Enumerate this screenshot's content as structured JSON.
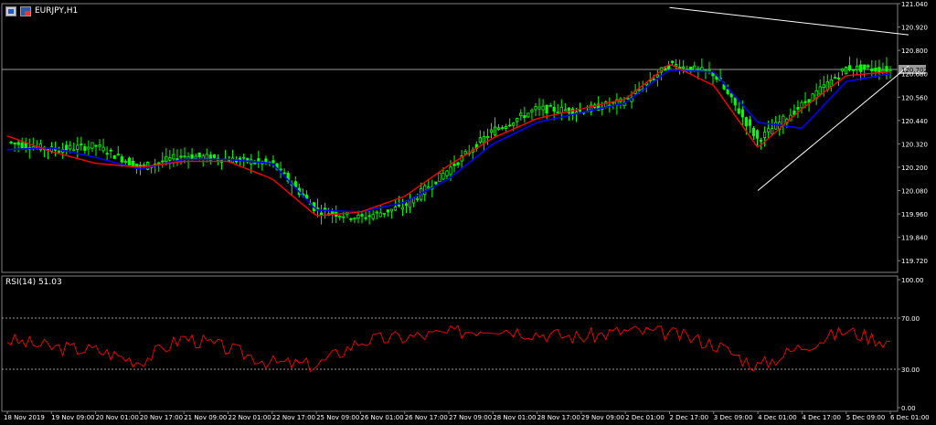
{
  "header": {
    "symbol": "EURJPY,H1"
  },
  "colors": {
    "background": "#000000",
    "grid": "#808080",
    "bull_candle": "#00ff00",
    "ma_fast": "#ff0000",
    "ma_slow": "#0000ff",
    "rsi": "#ff0000",
    "trendline": "#ffffff",
    "price_line": "#9a9a9a"
  },
  "rsi_panel": {
    "label": "RSI(14) 51.03"
  },
  "chart_data": [
    {
      "type": "line",
      "title": "EURJPY,H1",
      "x_tick_labels": [
        "18 Nov 2019",
        "19 Nov 09:00",
        "20 Nov 01:00",
        "20 Nov 17:00",
        "21 Nov 09:00",
        "22 Nov 01:00",
        "22 Nov 17:00",
        "25 Nov 09:00",
        "26 Nov 01:00",
        "26 Nov 17:00",
        "27 Nov 09:00",
        "28 Nov 01:00",
        "28 Nov 17:00",
        "29 Nov 09:00",
        "2 Dec 01:00",
        "2 Dec 17:00",
        "3 Dec 09:00",
        "4 Dec 01:00",
        "4 Dec 17:00",
        "5 Dec 09:00",
        "6 Dec 01:00"
      ],
      "y_tick_labels": [
        "121.040",
        "120.920",
        "120.800",
        "120.680",
        "120.560",
        "120.440",
        "120.320",
        "120.200",
        "120.080",
        "119.960",
        "119.840",
        "119.720"
      ],
      "ylim": [
        119.66,
        121.04
      ],
      "current_price_label": "120.702",
      "current_price": 120.702,
      "series": [
        {
          "x": [
            "18 Nov 2019",
            "19 Nov 09:00",
            "20 Nov 01:00",
            "20 Nov 17:00",
            "21 Nov 09:00",
            "22 Nov 01:00",
            "22 Nov 17:00",
            "25 Nov 09:00",
            "26 Nov 01:00",
            "26 Nov 17:00",
            "27 Nov 09:00",
            "28 Nov 01:00",
            "28 Nov 17:00",
            "29 Nov 09:00",
            "2 Dec 01:00",
            "2 Dec 17:00",
            "3 Dec 09:00",
            "4 Dec 01:00",
            "4 Dec 17:00",
            "5 Dec 09:00",
            "6 Dec 01:00"
          ],
          "values": [
            120.33,
            120.29,
            120.31,
            120.2,
            120.26,
            120.24,
            120.22,
            119.98,
            119.94,
            120.0,
            120.19,
            120.39,
            120.5,
            120.49,
            120.54,
            120.73,
            120.68,
            120.34,
            120.52,
            120.71,
            120.7
          ]
        },
        {
          "x": [
            "18 Nov 2019",
            "19 Nov 09:00",
            "20 Nov 01:00",
            "20 Nov 17:00",
            "21 Nov 09:00",
            "22 Nov 01:00",
            "22 Nov 17:00",
            "25 Nov 09:00",
            "26 Nov 01:00",
            "26 Nov 17:00",
            "27 Nov 09:00",
            "28 Nov 01:00",
            "28 Nov 17:00",
            "29 Nov 09:00",
            "2 Dec 01:00",
            "2 Dec 17:00",
            "3 Dec 09:00",
            "4 Dec 01:00",
            "4 Dec 17:00",
            "5 Dec 09:00",
            "6 Dec 01:00"
          ],
          "values": [
            120.36,
            120.28,
            120.22,
            120.2,
            120.23,
            120.23,
            120.14,
            119.95,
            119.97,
            120.05,
            120.21,
            120.35,
            120.45,
            120.5,
            120.55,
            120.73,
            120.62,
            120.3,
            120.5,
            120.67,
            120.69
          ]
        },
        {
          "x": [
            "18 Nov 2019",
            "19 Nov 09:00",
            "20 Nov 01:00",
            "20 Nov 17:00",
            "21 Nov 09:00",
            "22 Nov 01:00",
            "22 Nov 17:00",
            "25 Nov 09:00",
            "26 Nov 01:00",
            "26 Nov 17:00",
            "27 Nov 09:00",
            "28 Nov 01:00",
            "28 Nov 17:00",
            "29 Nov 09:00",
            "2 Dec 01:00",
            "2 Dec 17:00",
            "3 Dec 09:00",
            "4 Dec 01:00",
            "4 Dec 17:00",
            "5 Dec 09:00",
            "6 Dec 01:00"
          ],
          "values": [
            120.29,
            120.3,
            120.25,
            120.19,
            120.24,
            120.24,
            120.22,
            119.98,
            119.97,
            120.02,
            120.14,
            120.32,
            120.43,
            120.48,
            120.53,
            120.7,
            120.69,
            120.43,
            120.4,
            120.64,
            120.68
          ]
        }
      ],
      "trendlines": [
        {
          "from": {
            "x": "2 Dec 17:00",
            "y": 121.02
          },
          "to": {
            "x": "6 Dec 01:00",
            "y": 120.88
          }
        },
        {
          "from": {
            "x": "4 Dec 01:00",
            "y": 120.08
          },
          "to": {
            "x": "6 Dec 01:00",
            "y": 120.72
          }
        }
      ]
    },
    {
      "type": "line",
      "title": "RSI(14) 51.03",
      "y_tick_labels": [
        "100.00",
        "70.00",
        "30.00",
        "0.00"
      ],
      "ylim": [
        0,
        100
      ],
      "levels": [
        70,
        30
      ],
      "series": [
        {
          "x": [
            "18 Nov 2019",
            "19 Nov 09:00",
            "20 Nov 01:00",
            "20 Nov 17:00",
            "21 Nov 09:00",
            "22 Nov 01:00",
            "22 Nov 17:00",
            "25 Nov 09:00",
            "26 Nov 01:00",
            "26 Nov 17:00",
            "27 Nov 09:00",
            "28 Nov 01:00",
            "28 Nov 17:00",
            "29 Nov 09:00",
            "2 Dec 01:00",
            "2 Dec 17:00",
            "3 Dec 09:00",
            "4 Dec 01:00",
            "4 Dec 17:00",
            "5 Dec 09:00",
            "6 Dec 01:00"
          ],
          "values": [
            53,
            47,
            45,
            36,
            55,
            46,
            35,
            33,
            52,
            55,
            58,
            63,
            58,
            55,
            60,
            58,
            50,
            32,
            48,
            60,
            51
          ]
        }
      ]
    }
  ]
}
